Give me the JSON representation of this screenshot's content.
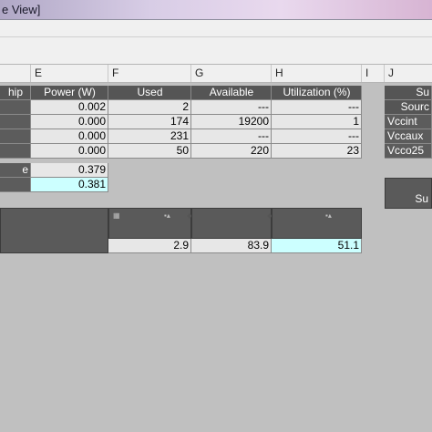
{
  "window": {
    "title": "e View]"
  },
  "columns": [
    "E",
    "F",
    "G",
    "H",
    "I",
    "J"
  ],
  "table": {
    "headers": {
      "chip": "hip",
      "power": "Power (W)",
      "used": "Used",
      "available": "Available",
      "utilization": "Utilization (%)"
    },
    "rows": [
      {
        "power": "0.002",
        "used": "2",
        "available": "---",
        "utilization": "---"
      },
      {
        "power": "0.000",
        "used": "174",
        "available": "19200",
        "utilization": "1"
      },
      {
        "power": "0.000",
        "used": "231",
        "available": "---",
        "utilization": "---"
      },
      {
        "power": "0.000",
        "used": "50",
        "available": "220",
        "utilization": "23"
      }
    ],
    "subtotal": {
      "label": "e",
      "power": "0.379"
    },
    "total": {
      "power": "0.381"
    }
  },
  "supply": {
    "header": "Su",
    "source_header": "Sourc",
    "sources": [
      "Vccint",
      "Vccaux",
      "Vcco25"
    ],
    "summary_header": "Su"
  },
  "bottom": {
    "values": [
      "2.9",
      "83.9",
      "51.1"
    ]
  },
  "colors": {
    "dark_cell": "#5c5c5c",
    "value_cell": "#e7e7e7",
    "highlight": "#ccffff",
    "background": "#c0c0c0"
  }
}
